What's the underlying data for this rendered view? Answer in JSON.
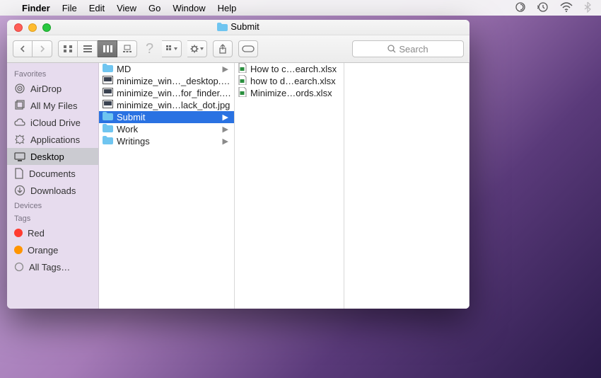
{
  "menubar": {
    "app": "Finder",
    "items": [
      "File",
      "Edit",
      "View",
      "Go",
      "Window",
      "Help"
    ]
  },
  "window": {
    "title": "Submit",
    "search_placeholder": "Search"
  },
  "sidebar": {
    "sections": [
      {
        "heading": "Favorites",
        "items": [
          {
            "icon": "airdrop",
            "label": "AirDrop"
          },
          {
            "icon": "allfiles",
            "label": "All My Files"
          },
          {
            "icon": "icloud",
            "label": "iCloud Drive"
          },
          {
            "icon": "apps",
            "label": "Applications"
          },
          {
            "icon": "desktop",
            "label": "Desktop",
            "selected": true
          },
          {
            "icon": "docs",
            "label": "Documents"
          },
          {
            "icon": "downloads",
            "label": "Downloads"
          }
        ]
      },
      {
        "heading": "Devices",
        "items": []
      },
      {
        "heading": "Tags",
        "items": [
          {
            "icon": "tag",
            "color": "#ff3b30",
            "label": "Red"
          },
          {
            "icon": "tag",
            "color": "#ff9500",
            "label": "Orange"
          },
          {
            "icon": "alltags",
            "label": "All Tags…"
          }
        ]
      }
    ]
  },
  "columns": [
    [
      {
        "type": "folder",
        "label": "MD",
        "arrow": true
      },
      {
        "type": "image",
        "label": "minimize_win…_desktop.jpg"
      },
      {
        "type": "image",
        "label": "minimize_win…for_finder.jpg"
      },
      {
        "type": "image",
        "label": "minimize_win…lack_dot.jpg"
      },
      {
        "type": "folder",
        "label": "Submit",
        "arrow": true,
        "selected": true
      },
      {
        "type": "folder",
        "label": "Work",
        "arrow": true
      },
      {
        "type": "folder",
        "label": "Writings",
        "arrow": true
      }
    ],
    [
      {
        "type": "xlsx",
        "label": "How to c…earch.xlsx"
      },
      {
        "type": "xlsx",
        "label": "how to d…earch.xlsx"
      },
      {
        "type": "xlsx",
        "label": "Minimize…ords.xlsx"
      }
    ]
  ]
}
